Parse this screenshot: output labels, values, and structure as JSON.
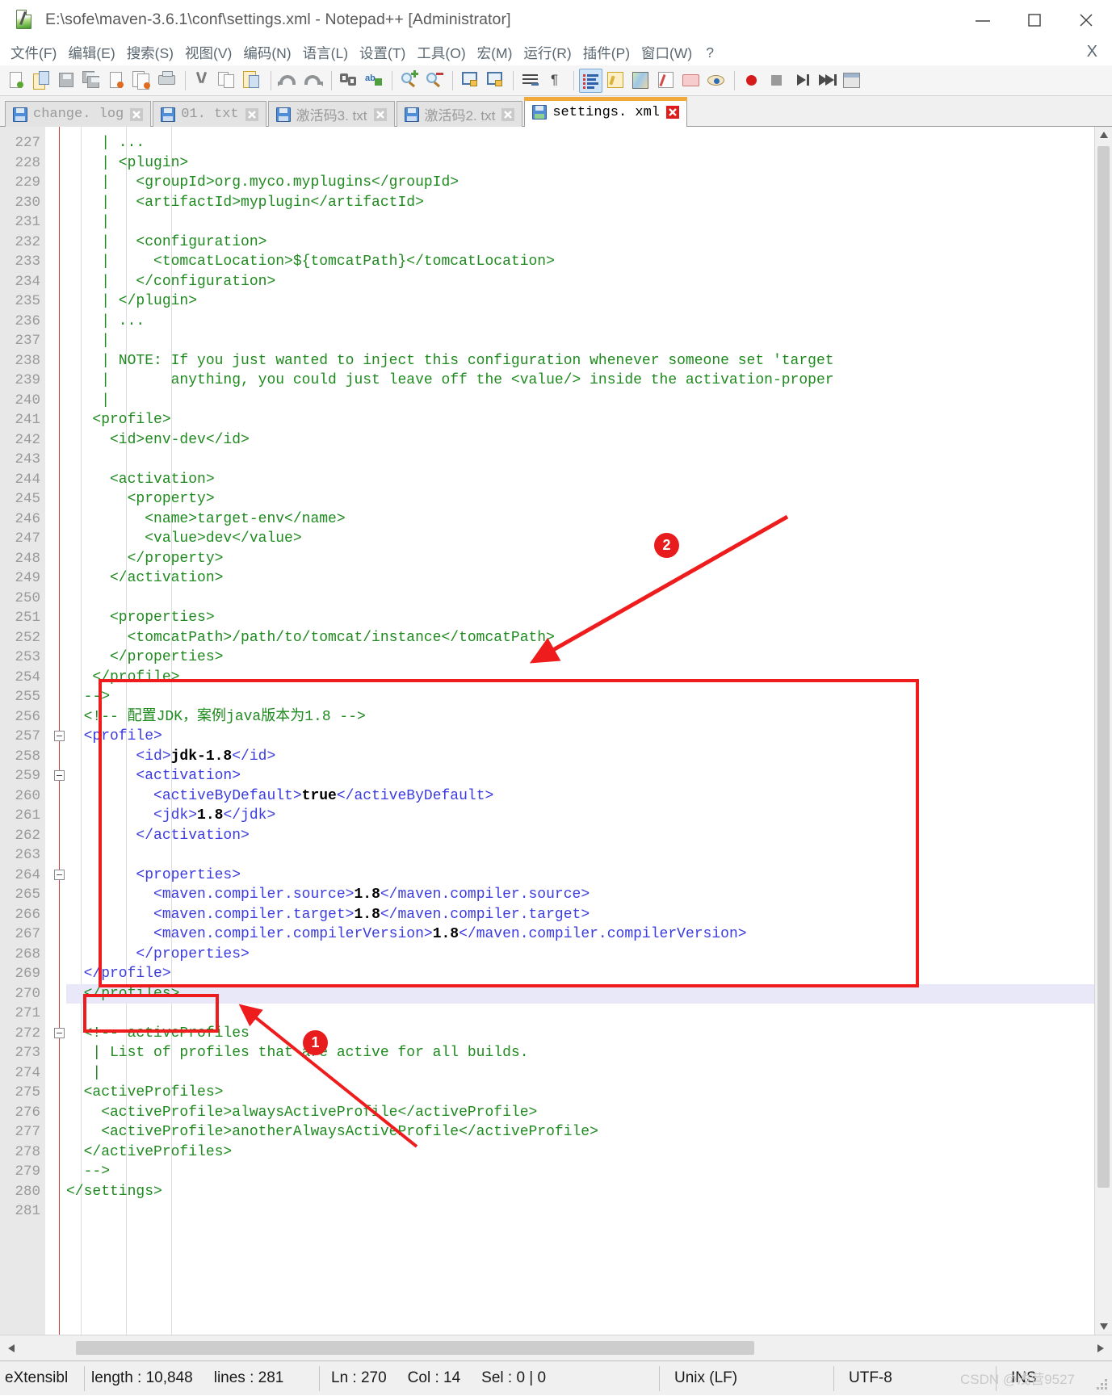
{
  "window": {
    "title": "E:\\sofe\\maven-3.6.1\\conf\\settings.xml - Notepad++ [Administrator]",
    "app_icon": "notepad-plus-plus-icon",
    "minimize_label": "–",
    "maximize_label": "☐",
    "close_label": "✕"
  },
  "menubar": {
    "items": [
      {
        "label": "文件(F)",
        "name": "menu-file"
      },
      {
        "label": "编辑(E)",
        "name": "menu-edit"
      },
      {
        "label": "搜索(S)",
        "name": "menu-search"
      },
      {
        "label": "视图(V)",
        "name": "menu-view"
      },
      {
        "label": "编码(N)",
        "name": "menu-encoding"
      },
      {
        "label": "语言(L)",
        "name": "menu-language"
      },
      {
        "label": "设置(T)",
        "name": "menu-settings"
      },
      {
        "label": "工具(O)",
        "name": "menu-tools"
      },
      {
        "label": "宏(M)",
        "name": "menu-macro"
      },
      {
        "label": "运行(R)",
        "name": "menu-run"
      },
      {
        "label": "插件(P)",
        "name": "menu-plugins"
      },
      {
        "label": "窗口(W)",
        "name": "menu-window"
      },
      {
        "label": "?",
        "name": "menu-help"
      }
    ],
    "close_doc_label": "X"
  },
  "toolbar": {
    "buttons": [
      {
        "name": "new-file-icon"
      },
      {
        "name": "open-file-icon"
      },
      {
        "name": "save-icon"
      },
      {
        "name": "save-all-icon"
      },
      {
        "name": "close-file-icon"
      },
      {
        "name": "close-all-files-icon"
      },
      {
        "name": "print-icon"
      },
      {
        "sep": true
      },
      {
        "name": "cut-icon"
      },
      {
        "name": "copy-icon"
      },
      {
        "name": "paste-icon"
      },
      {
        "sep": true
      },
      {
        "name": "undo-icon"
      },
      {
        "name": "redo-icon"
      },
      {
        "sep": true
      },
      {
        "name": "find-icon"
      },
      {
        "name": "replace-icon"
      },
      {
        "sep": true
      },
      {
        "name": "zoom-in-icon"
      },
      {
        "name": "zoom-out-icon"
      },
      {
        "sep": true
      },
      {
        "name": "sync-vertical-scroll-icon"
      },
      {
        "name": "sync-horizontal-scroll-icon"
      },
      {
        "sep": true
      },
      {
        "name": "word-wrap-icon"
      },
      {
        "name": "show-all-characters-icon"
      },
      {
        "sep": true
      },
      {
        "name": "indent-guide-icon"
      },
      {
        "name": "user-defined-language-icon"
      },
      {
        "name": "document-map-icon"
      },
      {
        "name": "function-list-icon"
      },
      {
        "name": "folder-as-workspace-icon"
      },
      {
        "name": "monitoring-icon"
      },
      {
        "sep": true
      },
      {
        "name": "record-macro-icon"
      },
      {
        "name": "stop-recording-icon"
      },
      {
        "name": "play-macro-icon"
      },
      {
        "name": "run-macro-multiple-icon"
      },
      {
        "name": "window-list-icon"
      }
    ]
  },
  "tabs": [
    {
      "label": "change. log",
      "icon": "floppy-blue-icon",
      "active": false,
      "cjk": false
    },
    {
      "label": "01. txt",
      "icon": "floppy-blue-icon",
      "active": false,
      "cjk": false
    },
    {
      "label": "激活码3. txt",
      "icon": "floppy-blue-icon",
      "active": false,
      "cjk": true
    },
    {
      "label": "激活码2. txt",
      "icon": "floppy-blue-icon",
      "active": false,
      "cjk": true
    },
    {
      "label": "settings. xml",
      "icon": "floppy-saved-icon",
      "active": true,
      "cjk": false
    }
  ],
  "editor": {
    "first_line_number": 227,
    "lines": [
      {
        "n": 227,
        "segments": [
          {
            "t": "    | ...",
            "c": "cmt"
          }
        ]
      },
      {
        "n": 228,
        "segments": [
          {
            "t": "    | <plugin>",
            "c": "cmt"
          }
        ]
      },
      {
        "n": 229,
        "segments": [
          {
            "t": "    |   <groupId>org.myco.myplugins</groupId>",
            "c": "cmt"
          }
        ]
      },
      {
        "n": 230,
        "segments": [
          {
            "t": "    |   <artifactId>myplugin</artifactId>",
            "c": "cmt"
          }
        ]
      },
      {
        "n": 231,
        "segments": [
          {
            "t": "    |",
            "c": "cmt"
          }
        ]
      },
      {
        "n": 232,
        "segments": [
          {
            "t": "    |   <configuration>",
            "c": "cmt"
          }
        ]
      },
      {
        "n": 233,
        "segments": [
          {
            "t": "    |     <tomcatLocation>${tomcatPath}</tomcatLocation>",
            "c": "cmt"
          }
        ]
      },
      {
        "n": 234,
        "segments": [
          {
            "t": "    |   </configuration>",
            "c": "cmt"
          }
        ]
      },
      {
        "n": 235,
        "segments": [
          {
            "t": "    | </plugin>",
            "c": "cmt"
          }
        ]
      },
      {
        "n": 236,
        "segments": [
          {
            "t": "    | ...",
            "c": "cmt"
          }
        ]
      },
      {
        "n": 237,
        "segments": [
          {
            "t": "    |",
            "c": "cmt"
          }
        ]
      },
      {
        "n": 238,
        "segments": [
          {
            "t": "    | NOTE: If you just wanted to inject this configuration whenever someone set 'target",
            "c": "cmt"
          }
        ]
      },
      {
        "n": 239,
        "segments": [
          {
            "t": "    |       anything, you could just leave off the <value/> inside the activation-proper",
            "c": "cmt"
          }
        ]
      },
      {
        "n": 240,
        "segments": [
          {
            "t": "    |",
            "c": "cmt"
          }
        ]
      },
      {
        "n": 241,
        "segments": [
          {
            "t": "   <profile>",
            "c": "cmt"
          }
        ]
      },
      {
        "n": 242,
        "segments": [
          {
            "t": "     <id>env-dev</id>",
            "c": "cmt"
          }
        ]
      },
      {
        "n": 243,
        "segments": [
          {
            "t": "",
            "c": "cmt"
          }
        ]
      },
      {
        "n": 244,
        "segments": [
          {
            "t": "     <activation>",
            "c": "cmt"
          }
        ]
      },
      {
        "n": 245,
        "segments": [
          {
            "t": "       <property>",
            "c": "cmt"
          }
        ]
      },
      {
        "n": 246,
        "segments": [
          {
            "t": "         <name>target-env</name>",
            "c": "cmt"
          }
        ]
      },
      {
        "n": 247,
        "segments": [
          {
            "t": "         <value>dev</value>",
            "c": "cmt"
          }
        ]
      },
      {
        "n": 248,
        "segments": [
          {
            "t": "       </property>",
            "c": "cmt"
          }
        ]
      },
      {
        "n": 249,
        "segments": [
          {
            "t": "     </activation>",
            "c": "cmt"
          }
        ]
      },
      {
        "n": 250,
        "segments": [
          {
            "t": "",
            "c": "cmt"
          }
        ]
      },
      {
        "n": 251,
        "segments": [
          {
            "t": "     <properties>",
            "c": "cmt"
          }
        ]
      },
      {
        "n": 252,
        "segments": [
          {
            "t": "       <tomcatPath>/path/to/tomcat/instance</tomcatPath>",
            "c": "cmt"
          }
        ]
      },
      {
        "n": 253,
        "segments": [
          {
            "t": "     </properties>",
            "c": "cmt"
          }
        ]
      },
      {
        "n": 254,
        "segments": [
          {
            "t": "   </profile>",
            "c": "cmt"
          }
        ]
      },
      {
        "n": 255,
        "segments": [
          {
            "t": "  -->",
            "c": "cmt"
          }
        ]
      },
      {
        "n": 256,
        "segments": [
          {
            "t": "  <!-- 配置JDK，案例java版本为1.8 -->",
            "c": "cmt"
          }
        ]
      },
      {
        "n": 257,
        "segments": [
          {
            "t": "  <profile>",
            "c": "tag"
          }
        ]
      },
      {
        "n": 258,
        "segments": [
          {
            "t": "        <id>",
            "c": "tag"
          },
          {
            "t": "jdk-1.8",
            "c": "val"
          },
          {
            "t": "</id>",
            "c": "tag"
          }
        ]
      },
      {
        "n": 259,
        "segments": [
          {
            "t": "        <activation>",
            "c": "tag"
          }
        ]
      },
      {
        "n": 260,
        "segments": [
          {
            "t": "          <activeByDefault>",
            "c": "tag"
          },
          {
            "t": "true",
            "c": "val"
          },
          {
            "t": "</activeByDefault>",
            "c": "tag"
          }
        ]
      },
      {
        "n": 261,
        "segments": [
          {
            "t": "          <jdk>",
            "c": "tag"
          },
          {
            "t": "1.8",
            "c": "val"
          },
          {
            "t": "</jdk>",
            "c": "tag"
          }
        ]
      },
      {
        "n": 262,
        "segments": [
          {
            "t": "        </activation>",
            "c": "tag"
          }
        ]
      },
      {
        "n": 263,
        "segments": [
          {
            "t": "",
            "c": "tag"
          }
        ]
      },
      {
        "n": 264,
        "segments": [
          {
            "t": "        <properties>",
            "c": "tag"
          }
        ]
      },
      {
        "n": 265,
        "segments": [
          {
            "t": "          <maven.compiler.source>",
            "c": "tag"
          },
          {
            "t": "1.8",
            "c": "val"
          },
          {
            "t": "</maven.compiler.source>",
            "c": "tag"
          }
        ]
      },
      {
        "n": 266,
        "segments": [
          {
            "t": "          <maven.compiler.target>",
            "c": "tag"
          },
          {
            "t": "1.8",
            "c": "val"
          },
          {
            "t": "</maven.compiler.target>",
            "c": "tag"
          }
        ]
      },
      {
        "n": 267,
        "segments": [
          {
            "t": "          <maven.compiler.compilerVersion>",
            "c": "tag"
          },
          {
            "t": "1.8",
            "c": "val"
          },
          {
            "t": "</maven.compiler.compilerVersion>",
            "c": "tag"
          }
        ]
      },
      {
        "n": 268,
        "segments": [
          {
            "t": "        </properties>",
            "c": "tag"
          }
        ]
      },
      {
        "n": 269,
        "segments": [
          {
            "t": "  </profile>",
            "c": "tag"
          }
        ]
      },
      {
        "n": 270,
        "segments": [
          {
            "t": "  </profiles>",
            "c": "cmt"
          }
        ]
      },
      {
        "n": 271,
        "segments": [
          {
            "t": "",
            "c": "cmt"
          }
        ]
      },
      {
        "n": 272,
        "segments": [
          {
            "t": "  <!-- activeProfiles",
            "c": "cmt"
          }
        ]
      },
      {
        "n": 273,
        "segments": [
          {
            "t": "   | List of profiles that are active for all builds.",
            "c": "cmt"
          }
        ]
      },
      {
        "n": 274,
        "segments": [
          {
            "t": "   |",
            "c": "cmt"
          }
        ]
      },
      {
        "n": 275,
        "segments": [
          {
            "t": "  <activeProfiles>",
            "c": "cmt"
          }
        ]
      },
      {
        "n": 276,
        "segments": [
          {
            "t": "    <activeProfile>alwaysActiveProfile</activeProfile>",
            "c": "cmt"
          }
        ]
      },
      {
        "n": 277,
        "segments": [
          {
            "t": "    <activeProfile>anotherAlwaysActiveProfile</activeProfile>",
            "c": "cmt"
          }
        ]
      },
      {
        "n": 278,
        "segments": [
          {
            "t": "  </activeProfiles>",
            "c": "cmt"
          }
        ]
      },
      {
        "n": 279,
        "segments": [
          {
            "t": "  -->",
            "c": "cmt"
          }
        ]
      },
      {
        "n": 280,
        "segments": [
          {
            "t": "</settings>",
            "c": "cmt"
          }
        ]
      },
      {
        "n": 281,
        "segments": [
          {
            "t": "",
            "c": "cmt"
          }
        ]
      }
    ],
    "highlighted_line": 270,
    "fold_markers": [
      257,
      259,
      264,
      272
    ]
  },
  "annotations": [
    {
      "name": "annotation-badge-1",
      "label": "1"
    },
    {
      "name": "annotation-badge-2",
      "label": "2"
    }
  ],
  "statusbar": {
    "language": "eXtensibl",
    "length_label": "length : 10,848",
    "lines_label": "lines : 281",
    "ln_label": "Ln : 270",
    "col_label": "Col : 14",
    "sel_label": "Sel : 0 | 0",
    "eol": "Unix (LF)",
    "encoding": "UTF-8",
    "insert_mode": "INS",
    "watermark": "CSDN @浅营9527"
  },
  "colors": {
    "accent_tab": "#f2a93b",
    "annotation": "#ee1c1c",
    "comment": "#1f8a1f",
    "tag": "#3b3be0",
    "value": "#000000",
    "gutter_bg": "#e8e8e8",
    "highlight_line": "#e8e8f8"
  }
}
